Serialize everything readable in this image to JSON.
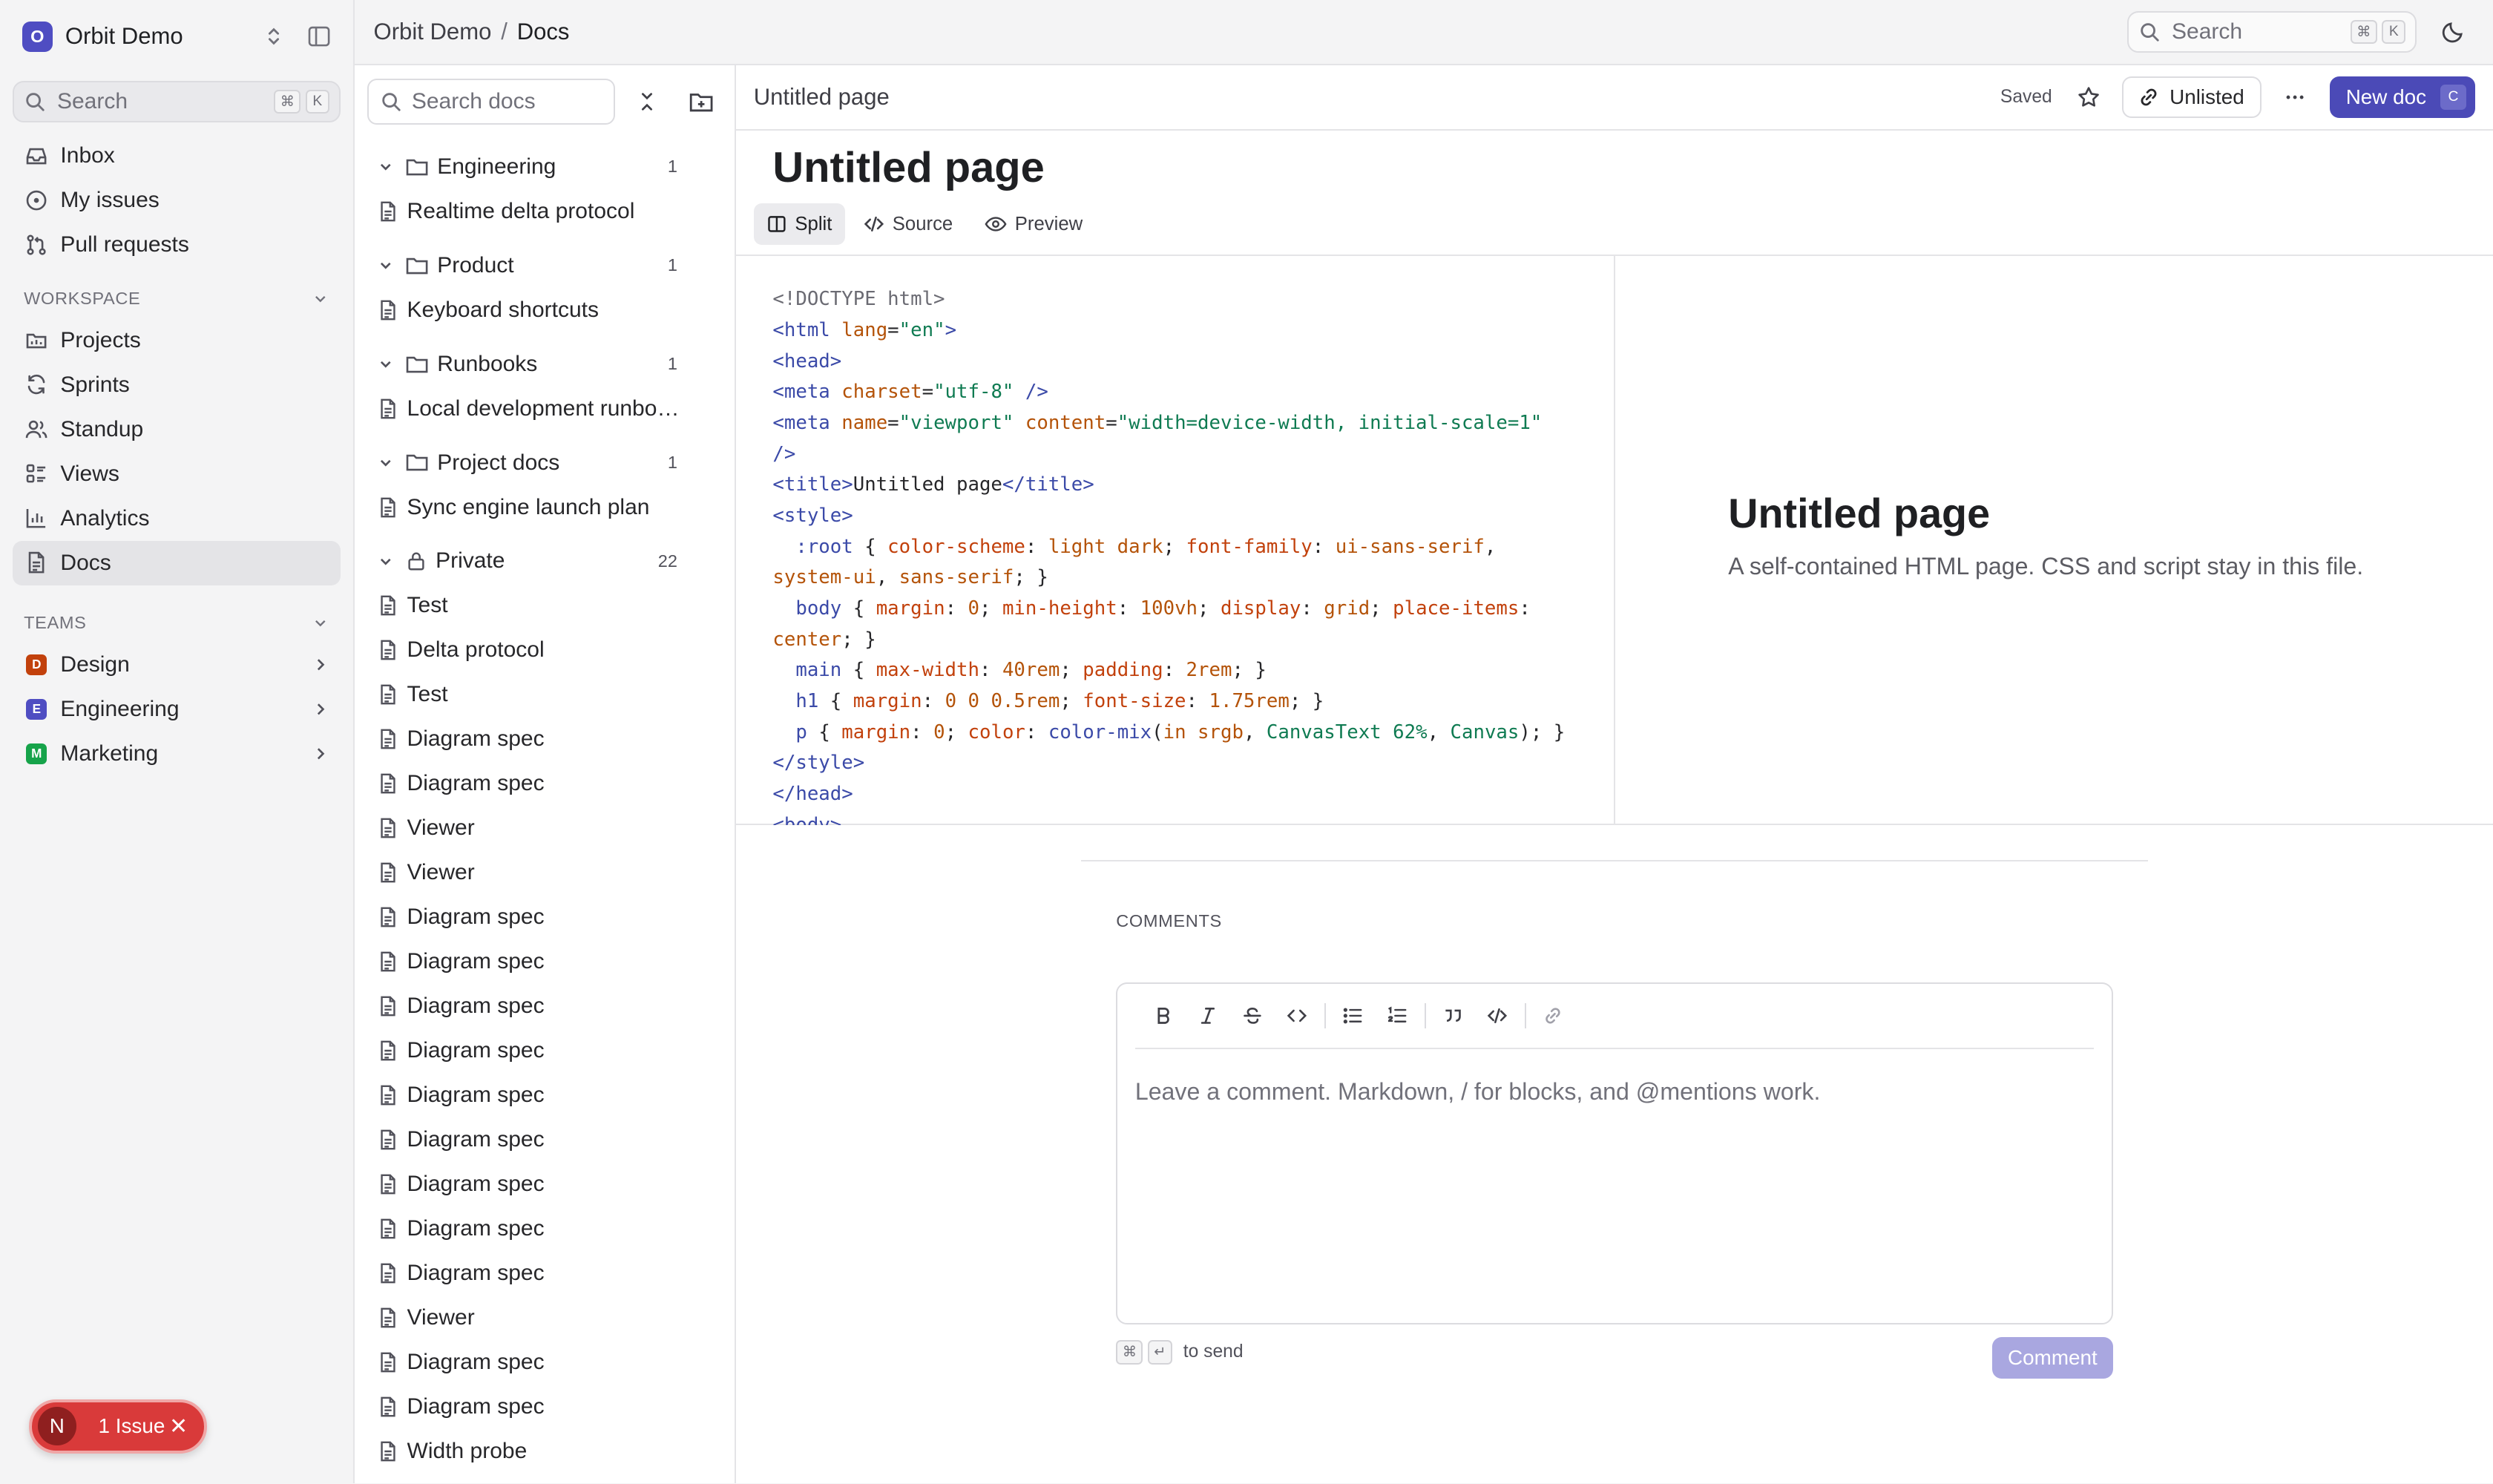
{
  "workspace": {
    "initial": "O",
    "name": "Orbit Demo",
    "color": "#4f4dc2"
  },
  "sidebar": {
    "search": {
      "label": "Search",
      "keys": [
        "⌘",
        "K"
      ]
    },
    "primary": [
      {
        "label": "Inbox",
        "icon": "inbox-icon"
      },
      {
        "label": "My issues",
        "icon": "circle-dot-icon"
      },
      {
        "label": "Pull requests",
        "icon": "git-pull-request-icon"
      }
    ],
    "workspace_section": "WORKSPACE",
    "workspace_items": [
      {
        "label": "Projects",
        "icon": "projects-icon"
      },
      {
        "label": "Sprints",
        "icon": "sprints-icon"
      },
      {
        "label": "Standup",
        "icon": "users-icon"
      },
      {
        "label": "Views",
        "icon": "views-icon"
      },
      {
        "label": "Analytics",
        "icon": "bar-chart-icon"
      },
      {
        "label": "Docs",
        "icon": "doc-icon",
        "active": true
      }
    ],
    "teams_section": "TEAMS",
    "teams": [
      {
        "initial": "D",
        "label": "Design",
        "color": "#c2410c"
      },
      {
        "initial": "E",
        "label": "Engineering",
        "color": "#4f4dc2"
      },
      {
        "initial": "M",
        "label": "Marketing",
        "color": "#16a34a"
      }
    ],
    "issue_toast": {
      "avatar": "N",
      "label": "1 Issue"
    }
  },
  "topbar": {
    "breadcrumb": [
      "Orbit Demo",
      "Docs"
    ],
    "search": {
      "label": "Search",
      "keys": [
        "⌘",
        "K"
      ]
    }
  },
  "docs_panel": {
    "search_placeholder": "Search docs",
    "folders": [
      {
        "name": "Engineering",
        "count": "1",
        "docs": [
          "Realtime delta protocol"
        ]
      },
      {
        "name": "Product",
        "count": "1",
        "docs": [
          "Keyboard shortcuts"
        ]
      },
      {
        "name": "Runbooks",
        "count": "1",
        "docs": [
          "Local development runbook"
        ]
      },
      {
        "name": "Project docs",
        "count": "1",
        "docs": [
          "Sync engine launch plan"
        ]
      },
      {
        "name": "Private",
        "count": "22",
        "locked": true,
        "docs": [
          "Test",
          "Delta protocol",
          "Test",
          "Diagram spec",
          "Diagram spec",
          "Viewer",
          "Viewer",
          "Diagram spec",
          "Diagram spec",
          "Diagram spec",
          "Diagram spec",
          "Diagram spec",
          "Diagram spec",
          "Diagram spec",
          "Diagram spec",
          "Diagram spec",
          "Viewer",
          "Diagram spec",
          "Diagram spec",
          "Width probe"
        ]
      }
    ]
  },
  "editor": {
    "header_title": "Untitled page",
    "saved_label": "Saved",
    "unlisted_label": "Unlisted",
    "new_doc_label": "New doc",
    "new_doc_key": "C",
    "page_title": "Untitled page",
    "tabs": [
      {
        "label": "Split",
        "icon": "split-icon",
        "active": true
      },
      {
        "label": "Source",
        "icon": "code-icon"
      },
      {
        "label": "Preview",
        "icon": "eye-icon"
      }
    ],
    "source_lines": [
      [
        [
          "cm",
          "<!DOCTYPE html>"
        ]
      ],
      [
        [
          "tg",
          "<html"
        ],
        [
          "",
          " "
        ],
        [
          "at",
          "lang"
        ],
        [
          "",
          "="
        ],
        [
          "sv",
          "\"en\""
        ],
        [
          "tg",
          ">"
        ]
      ],
      [
        [
          "tg",
          "<head>"
        ]
      ],
      [
        [
          "tg",
          "<meta"
        ],
        [
          "",
          " "
        ],
        [
          "at",
          "charset"
        ],
        [
          "",
          "="
        ],
        [
          "sv",
          "\"utf-8\""
        ],
        [
          "",
          " "
        ],
        [
          "tg",
          "/>"
        ]
      ],
      [
        [
          "tg",
          "<meta"
        ],
        [
          "",
          " "
        ],
        [
          "at",
          "name"
        ],
        [
          "",
          "="
        ],
        [
          "sv",
          "\"viewport\""
        ],
        [
          "",
          " "
        ],
        [
          "at",
          "content"
        ],
        [
          "",
          "="
        ],
        [
          "sv",
          "\"width=device-width, initial-scale=1\""
        ]
      ],
      [
        [
          "tg",
          "/>"
        ]
      ],
      [
        [
          "tg",
          "<title>"
        ],
        [
          "",
          "Untitled page"
        ],
        [
          "tg",
          "</title>"
        ]
      ],
      [
        [
          "tg",
          "<style>"
        ]
      ],
      [
        [
          "",
          "  "
        ],
        [
          "sel",
          ":root"
        ],
        [
          "",
          " { "
        ],
        [
          "pr",
          "color-scheme"
        ],
        [
          "",
          ": "
        ],
        [
          "at",
          "light dark"
        ],
        [
          "",
          "; "
        ],
        [
          "pr",
          "font-family"
        ],
        [
          "",
          ": "
        ],
        [
          "at",
          "ui-sans-serif"
        ],
        [
          "",
          ","
        ]
      ],
      [
        [
          "at",
          "system-ui"
        ],
        [
          "",
          ", "
        ],
        [
          "at",
          "sans-serif"
        ],
        [
          "",
          "; }"
        ]
      ],
      [
        [
          "",
          "  "
        ],
        [
          "sel",
          "body"
        ],
        [
          "",
          " { "
        ],
        [
          "pr",
          "margin"
        ],
        [
          "",
          ": "
        ],
        [
          "at",
          "0"
        ],
        [
          "",
          "; "
        ],
        [
          "pr",
          "min-height"
        ],
        [
          "",
          ": "
        ],
        [
          "at",
          "100vh"
        ],
        [
          "",
          "; "
        ],
        [
          "pr",
          "display"
        ],
        [
          "",
          ": "
        ],
        [
          "at",
          "grid"
        ],
        [
          "",
          "; "
        ],
        [
          "pr",
          "place-items"
        ],
        [
          "",
          ":"
        ]
      ],
      [
        [
          "at",
          "center"
        ],
        [
          "",
          "; }"
        ]
      ],
      [
        [
          "",
          "  "
        ],
        [
          "sel",
          "main"
        ],
        [
          "",
          " { "
        ],
        [
          "pr",
          "max-width"
        ],
        [
          "",
          ": "
        ],
        [
          "at",
          "40rem"
        ],
        [
          "",
          "; "
        ],
        [
          "pr",
          "padding"
        ],
        [
          "",
          ": "
        ],
        [
          "at",
          "2rem"
        ],
        [
          "",
          "; }"
        ]
      ],
      [
        [
          "",
          "  "
        ],
        [
          "sel",
          "h1"
        ],
        [
          "",
          " { "
        ],
        [
          "pr",
          "margin"
        ],
        [
          "",
          ": "
        ],
        [
          "at",
          "0 0 0.5rem"
        ],
        [
          "",
          "; "
        ],
        [
          "pr",
          "font-size"
        ],
        [
          "",
          ": "
        ],
        [
          "at",
          "1.75rem"
        ],
        [
          "",
          "; }"
        ]
      ],
      [
        [
          "",
          "  "
        ],
        [
          "sel",
          "p"
        ],
        [
          "",
          " { "
        ],
        [
          "pr",
          "margin"
        ],
        [
          "",
          ": "
        ],
        [
          "at",
          "0"
        ],
        [
          "",
          "; "
        ],
        [
          "pr",
          "color"
        ],
        [
          "",
          ": "
        ],
        [
          "sel",
          "color-mix"
        ],
        [
          "",
          "("
        ],
        [
          "at",
          "in srgb"
        ],
        [
          "",
          ", "
        ],
        [
          "nm",
          "CanvasText 62%"
        ],
        [
          "",
          ", "
        ],
        [
          "nm",
          "Canvas"
        ],
        [
          "",
          "); }"
        ]
      ],
      [
        [
          "tg",
          "</style>"
        ]
      ],
      [
        [
          "tg",
          "</head>"
        ]
      ],
      [
        [
          "tg",
          "<body>"
        ]
      ]
    ],
    "preview": {
      "heading": "Untitled page",
      "text": "A self-contained HTML page. CSS and script stay in this file."
    }
  },
  "comments": {
    "label": "COMMENTS",
    "placeholder": "Leave a comment. Markdown, / for blocks, and @mentions work.",
    "send_hint": "to send",
    "send_keys": [
      "⌘",
      "↵"
    ],
    "submit_label": "Comment"
  }
}
